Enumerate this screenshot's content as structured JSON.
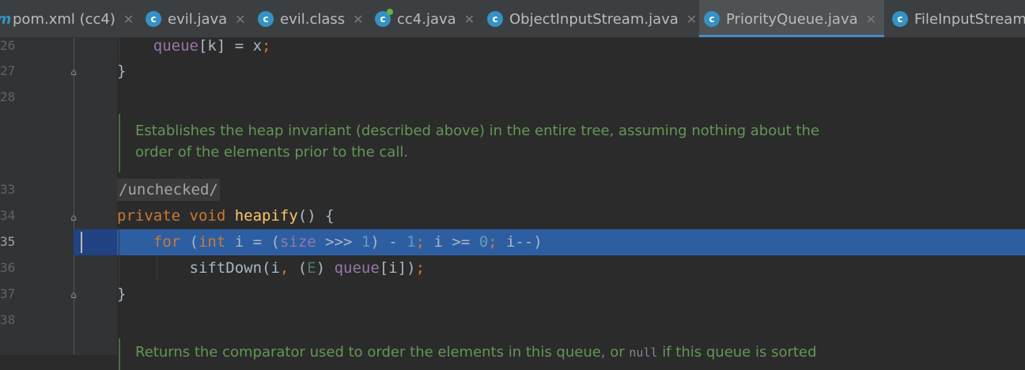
{
  "tabs": [
    {
      "label": "pom.xml (cc4)",
      "icon": "maven-icon",
      "active": false
    },
    {
      "label": "evil.java",
      "icon": "class-icon",
      "active": false
    },
    {
      "label": "evil.class",
      "icon": "class-icon",
      "active": false
    },
    {
      "label": "cc4.java",
      "icon": "class-modified-icon",
      "active": false
    },
    {
      "label": "ObjectInputStream.java",
      "icon": "class-icon",
      "active": false
    },
    {
      "label": "PriorityQueue.java",
      "icon": "class-icon",
      "active": true
    },
    {
      "label": "FileInputStream",
      "icon": "class-icon",
      "active": false
    }
  ],
  "line_numbers": {
    "l1": "26",
    "l2": "27",
    "l3": "28",
    "l4": "33",
    "l5": "34",
    "l6": "35",
    "l7": "36",
    "l8": "37",
    "l9": "38"
  },
  "code": {
    "l1_a": "queue",
    "l1_b": "[k] = x",
    "l1_c": ";",
    "l2": "}",
    "doc1_line1": "Establishes the heap invariant (described above) in the entire tree, assuming nothing about the",
    "doc1_line2": "order of the elements prior to the call.",
    "annotation": "/unchecked/",
    "l5_kw1": "private ",
    "l5_kw2": "void ",
    "l5_fn": "heapify",
    "l5_rest": "() {",
    "l6_kw": "for ",
    "l6_p1": "(",
    "l6_type": "int ",
    "l6_p2": "i = (",
    "l6_fld": "size",
    "l6_p3": " >>> ",
    "l6_n1": "1",
    "l6_p4": ") - ",
    "l6_n2": "1",
    "l6_s1": "; ",
    "l6_p5": "i >= ",
    "l6_n3": "0",
    "l6_s2": "; ",
    "l6_p6": "i--)",
    "l7_a": "siftDown(i",
    "l7_s": ", ",
    "l7_b": "(",
    "l7_gen": "E",
    "l7_c": ") ",
    "l7_fld": "queue",
    "l7_d": "[i])",
    "l7_sem": ";",
    "l8": "}",
    "doc2_part1": "Returns the comparator used to order the elements in this queue, or ",
    "doc2_code": "null",
    "doc2_part2": " if this queue is sorted"
  },
  "colors": {
    "keyword": "#cc7832",
    "field": "#9876aa",
    "number": "#6897bb",
    "method": "#ffc66d",
    "doc": "#629755",
    "selection": "#2d5ea2"
  }
}
